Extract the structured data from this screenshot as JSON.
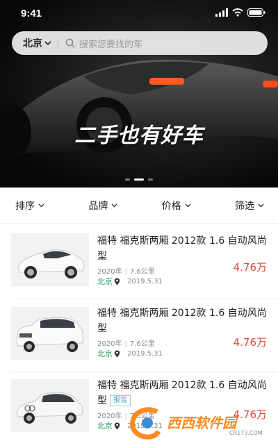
{
  "status_bar": {
    "time": "9:41"
  },
  "search": {
    "city": "北京",
    "placeholder": "搜索您要找的车"
  },
  "hero": {
    "slogan": "二手也有好车",
    "dots": 3,
    "active_dot": 1
  },
  "filters": [
    {
      "label": "排序"
    },
    {
      "label": "品牌"
    },
    {
      "label": "价格"
    },
    {
      "label": "筛选"
    }
  ],
  "listings": [
    {
      "title": "福特 福克斯两厢 2012款 1.6 自动风尚型",
      "tag": "",
      "year": "2020年",
      "mileage": "7.6公里",
      "city": "北京",
      "date": "2019.5.31",
      "price": "4.76万",
      "car_color": "#ffffff"
    },
    {
      "title": "福特 福克斯两厢 2012款 1.6 自动风尚型",
      "tag": "",
      "year": "2020年",
      "mileage": "7.6公里",
      "city": "北京",
      "date": "2019.5.31",
      "price": "4.76万",
      "car_color": "#f5f5f5"
    },
    {
      "title": "福特 福克斯两厢 2012款 1.6 自动风尚型",
      "tag": "报告",
      "year": "2020年",
      "mileage": "7.6公里",
      "city": "北京",
      "date": "2019.5.31",
      "price": "4.76万",
      "car_color": "#eeeeee"
    }
  ],
  "watermark": {
    "text": "西西软件园",
    "sub": "CR173.COM"
  },
  "colors": {
    "price": "#e2463a",
    "city": "#29a366",
    "tag": "#3aa7b8"
  }
}
